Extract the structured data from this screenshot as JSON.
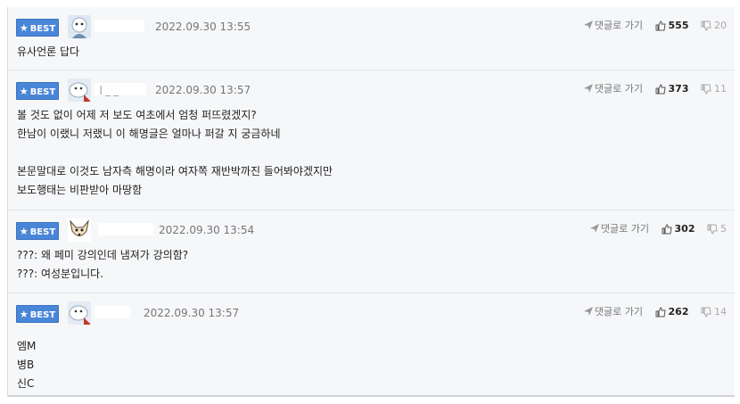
{
  "best_label": "BEST",
  "reply_label": "댓글로 가기",
  "comments": [
    {
      "nickname": "",
      "date": "2022.09.30 13:55",
      "likes": "555",
      "dislikes": "20",
      "lines": [
        "유사언론 답다"
      ]
    },
    {
      "nickname": "ㅣ_ _",
      "date": "2022.09.30 13:57",
      "likes": "373",
      "dislikes": "11",
      "lines": [
        "볼 것도 없이 어제 저 보도 여초에서 엄청 퍼뜨렸겠지?",
        "한남이 이랬니 저랬니 이 해명글은 얼마나 퍼갈 지 궁금하네",
        "",
        "본문말대로 이것도 남자측 해명이라 여자쪽 재반박까진 들어봐야겠지만",
        "보도행태는 비판받아 마땅함"
      ]
    },
    {
      "nickname": "",
      "date": "2022.09.30 13:54",
      "likes": "302",
      "dislikes": "5",
      "lines": [
        "???: 왜 페미 강의인데 냄져가 강의함?",
        "???: 여성분입니다."
      ]
    },
    {
      "nickname": "",
      "date": "2022.09.30 13:57",
      "likes": "262",
      "dislikes": "14",
      "lines": [
        "엠M",
        "병B",
        "신C"
      ]
    }
  ]
}
